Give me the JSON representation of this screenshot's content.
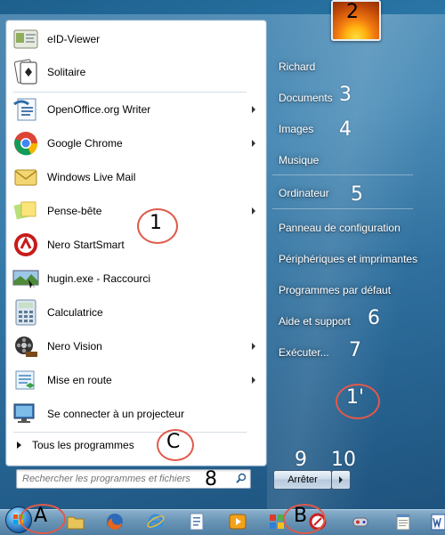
{
  "start_menu": {
    "programs": [
      {
        "label": "eID-Viewer",
        "icon": "eid-card-icon",
        "submenu": false
      },
      {
        "label": "Solitaire",
        "icon": "solitaire-cards-icon",
        "submenu": false
      },
      {
        "label": "OpenOffice.org Writer",
        "icon": "openoffice-writer-icon",
        "submenu": true
      },
      {
        "label": "Google Chrome",
        "icon": "chrome-icon",
        "submenu": true
      },
      {
        "label": "Windows Live Mail",
        "icon": "mail-envelope-icon",
        "submenu": false
      },
      {
        "label": "Pense-bête",
        "icon": "sticky-notes-icon",
        "submenu": true
      },
      {
        "label": "Nero StartSmart",
        "icon": "nero-icon",
        "submenu": false
      },
      {
        "label": "hugin.exe - Raccourci",
        "icon": "hugin-panorama-icon",
        "submenu": false
      },
      {
        "label": "Calculatrice",
        "icon": "calculator-icon",
        "submenu": false
      },
      {
        "label": "Nero Vision",
        "icon": "film-reel-icon",
        "submenu": true
      },
      {
        "label": "Mise en route",
        "icon": "getting-started-icon",
        "submenu": true
      },
      {
        "label": "Se connecter à un projecteur",
        "icon": "projector-monitor-icon",
        "submenu": false
      }
    ],
    "all_programs": "Tous les programmes",
    "search_placeholder": "Rechercher les programmes et fichiers",
    "right_column": [
      "Richard",
      "Documents",
      "Images",
      "Musique",
      "Ordinateur",
      "Panneau de configuration",
      "Périphériques et imprimantes",
      "Programmes par défaut",
      "Aide et support",
      "Exécuter..."
    ],
    "shutdown_label": "Arrêter"
  },
  "annotations": {
    "n1": "1",
    "n1p": "1'",
    "n2": "2",
    "n3": "3",
    "n4": "4",
    "n5": "5",
    "n6": "6",
    "n7": "7",
    "n8": "8",
    "n9": "9",
    "n10": "10",
    "A": "A",
    "B": "B",
    "C": "C"
  },
  "colors": {
    "annotation_circle": "#e05a4a",
    "desktop_blue": "#1d5f8d"
  }
}
